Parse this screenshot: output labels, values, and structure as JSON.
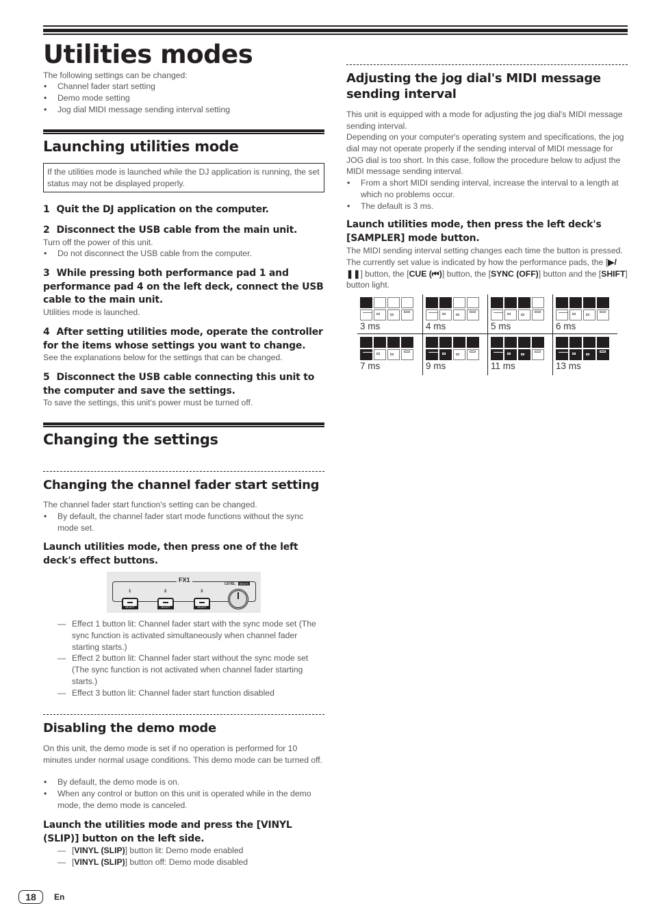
{
  "page": {
    "title": "Utilities modes",
    "intro": "The following settings can be changed:",
    "intro_bullets": [
      "Channel fader start setting",
      "Demo mode setting",
      "Jog dial MIDI message sending interval setting"
    ],
    "page_number": "18",
    "language": "En"
  },
  "launching": {
    "heading": "Launching utilities mode",
    "note": "If the utilities mode is launched while the DJ application is running, the set status may not be displayed properly.",
    "steps": [
      {
        "num": "1",
        "text": "Quit the DJ application on the computer.",
        "detail": "",
        "bullets": []
      },
      {
        "num": "2",
        "text": "Disconnect the USB cable from the main unit.",
        "detail": "Turn off the power of this unit.",
        "bullets": [
          "Do not disconnect the USB cable from the computer."
        ]
      },
      {
        "num": "3",
        "text": "While pressing both performance pad 1 and performance pad 4 on the left deck, connect the USB cable to the main unit.",
        "detail": "Utilities mode is launched.",
        "bullets": []
      },
      {
        "num": "4",
        "text": "After setting utilities mode, operate the controller for the items whose settings you want to change.",
        "detail": "See the explanations below for the settings that can be changed.",
        "bullets": []
      },
      {
        "num": "5",
        "text": "Disconnect the USB cable connecting this unit to the computer and save the settings.",
        "detail": "To save the settings, this unit's power must be turned off.",
        "bullets": []
      }
    ]
  },
  "changing": {
    "heading": "Changing the settings",
    "fader": {
      "heading": "Changing the channel fader start setting",
      "body": "The channel fader start function's setting can be changed.",
      "bullets": [
        "By default, the channel fader start mode functions without the sync mode set."
      ],
      "instruction": "Launch utilities mode, then press one of the left deck's effect buttons.",
      "illustration": {
        "group_label": "FX1",
        "buttons": [
          "1",
          "2",
          "3"
        ],
        "button_sublabel": "SELECT",
        "knob_label": "LEVEL",
        "knob_sublabel": "BEATS"
      },
      "options": [
        "Effect 1 button lit: Channel fader start with the sync mode set (The sync function is activated simultaneously when channel fader starting starts.)",
        "Effect 2 button lit: Channel fader start without the sync mode set (The sync function is not activated when channel fader starting starts.)",
        "Effect 3 button lit: Channel fader start function disabled"
      ]
    },
    "demo": {
      "heading": "Disabling the demo mode",
      "body": "On this unit, the demo mode is set if no operation is performed for 10 minutes under normal usage conditions. This demo mode can be turned off.",
      "bullets": [
        "By default, the demo mode is on.",
        "When any control or button on this unit is operated while in the demo mode, the demo mode is canceled."
      ],
      "instruction": "Launch the utilities mode and press the [VINYL (SLIP)] button on the left side.",
      "options": [
        {
          "bold": "VINYL (SLIP)",
          "text": "] button lit: Demo mode enabled"
        },
        {
          "bold": "VINYL (SLIP)",
          "text": "] button off: Demo mode disabled"
        }
      ]
    }
  },
  "jog": {
    "heading": "Adjusting the jog dial's MIDI message sending interval",
    "body1": "This unit is equipped with a mode for adjusting the jog dial's MIDI message sending interval.",
    "body2": "Depending on your computer's operating system and specifications, the jog dial may not operate properly if the sending interval of MIDI message for JOG dial is too short. In this case, follow the procedure below to adjust the MIDI message sending interval.",
    "bullets": [
      "From a short MIDI sending interval, increase the interval to a length at which no problems occur.",
      "The default is 3 ms."
    ],
    "instruction": "Launch utilities mode, then press the left deck's [SAMPLER] mode button.",
    "desc": {
      "t1": "The MIDI sending interval setting changes each time the button is pressed. The currently set value is indicated by how the performance pads, the [",
      "b1": "▶/❚❚",
      "t2": "] button, the [",
      "b2": "CUE (⏮)",
      "t3": "] button, the [",
      "b3": "SYNC (OFF)",
      "t4": "] button and the [",
      "b4": "SHIFT",
      "t5": "] button light."
    },
    "settings": [
      {
        "label": "3 ms",
        "pads": [
          1,
          0,
          0,
          0
        ],
        "buttons": [
          0,
          0,
          0,
          0
        ]
      },
      {
        "label": "4 ms",
        "pads": [
          1,
          1,
          0,
          0
        ],
        "buttons": [
          0,
          0,
          0,
          0
        ]
      },
      {
        "label": "5 ms",
        "pads": [
          1,
          1,
          1,
          0
        ],
        "buttons": [
          0,
          0,
          0,
          0
        ]
      },
      {
        "label": "6 ms",
        "pads": [
          1,
          1,
          1,
          1
        ],
        "buttons": [
          0,
          0,
          0,
          0
        ]
      },
      {
        "label": "7 ms",
        "pads": [
          1,
          1,
          1,
          1
        ],
        "buttons": [
          1,
          0,
          0,
          0
        ]
      },
      {
        "label": "9 ms",
        "pads": [
          1,
          1,
          1,
          1
        ],
        "buttons": [
          1,
          1,
          0,
          0
        ]
      },
      {
        "label": "11 ms",
        "pads": [
          1,
          1,
          1,
          1
        ],
        "buttons": [
          1,
          1,
          1,
          0
        ]
      },
      {
        "label": "13 ms",
        "pads": [
          1,
          1,
          1,
          1
        ],
        "buttons": [
          1,
          1,
          1,
          1
        ]
      }
    ],
    "button_icons": [
      "play-pause-icon",
      "cue-icon",
      "sync-icon",
      "shift-icon"
    ]
  }
}
